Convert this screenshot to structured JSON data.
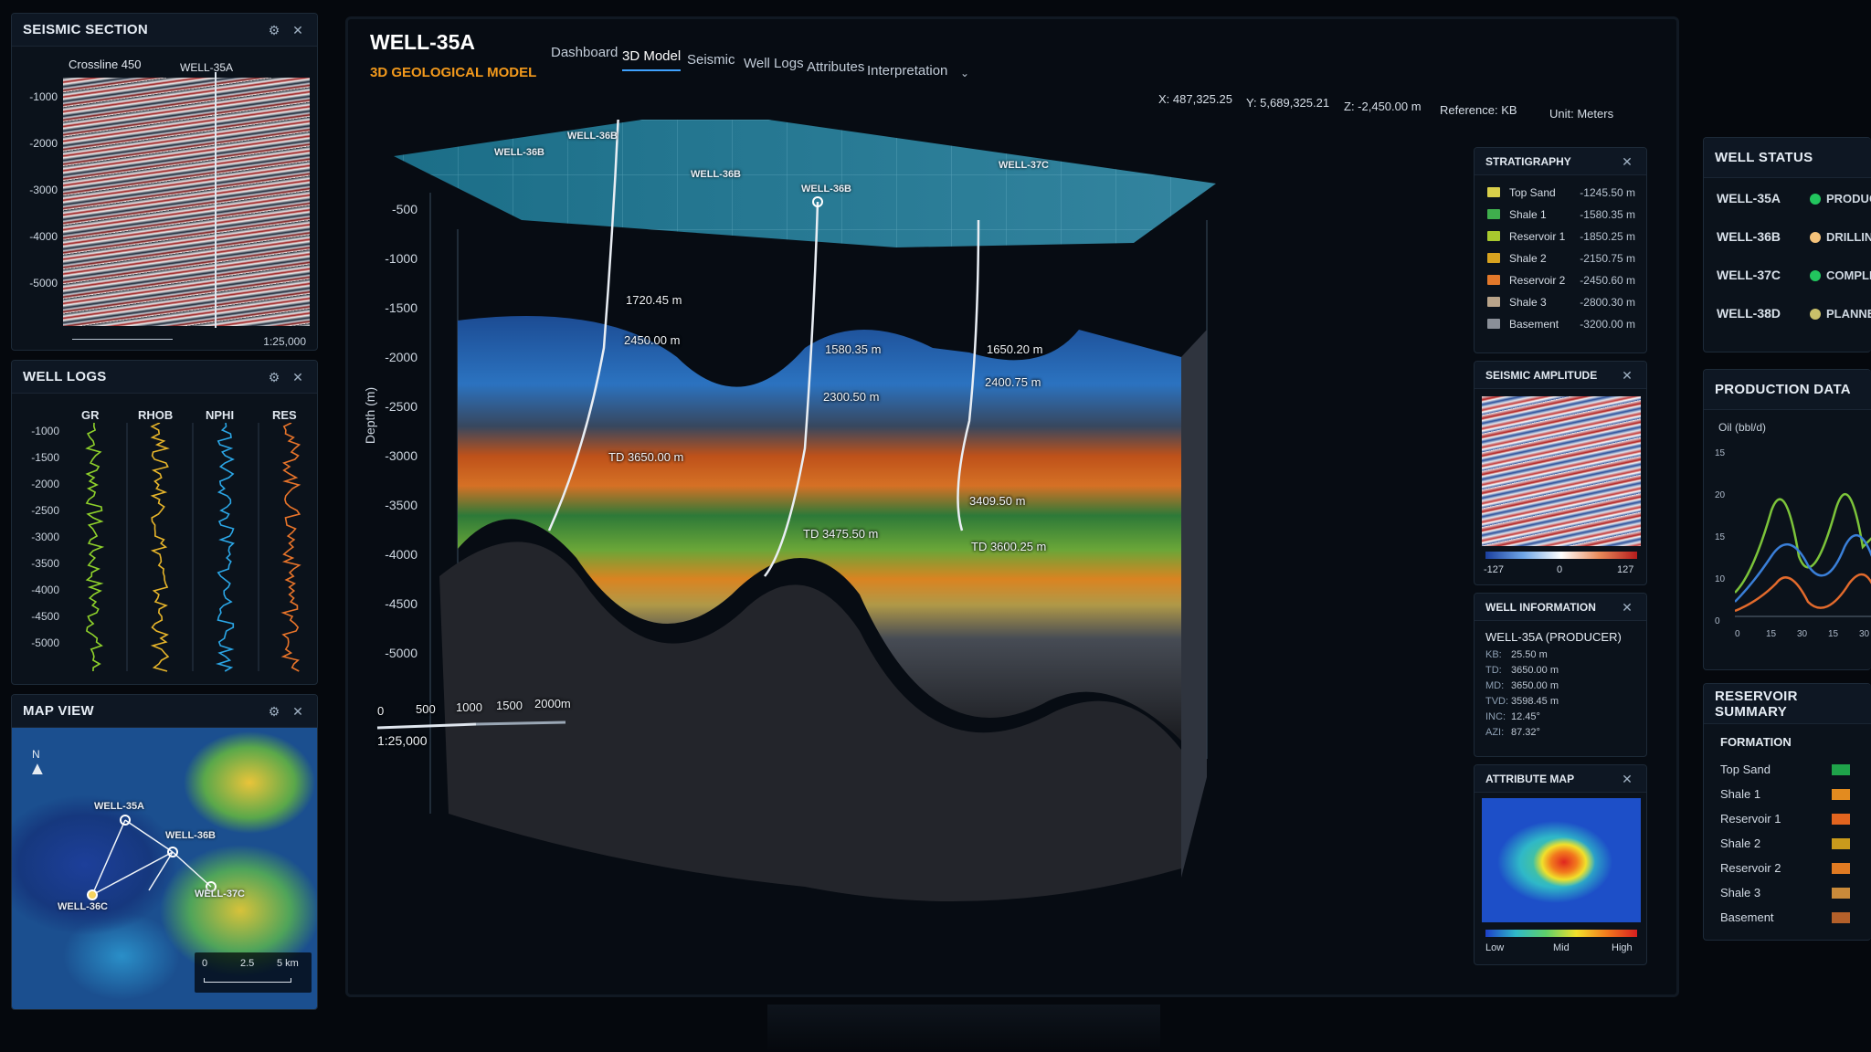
{
  "seismic_section": {
    "title": "SEISMIC SECTION",
    "crossline": "Crossline 450",
    "well": "WELL-35A",
    "depths": [
      "-1000",
      "-2000",
      "-3000",
      "-4000",
      "-5000"
    ],
    "scale": "1:25,000"
  },
  "well_logs": {
    "title": "WELL LOGS",
    "columns": [
      "GR",
      "RHOB",
      "NPHI",
      "RES"
    ],
    "colors": [
      "#8fd22b",
      "#e7b52a",
      "#2ba6e6",
      "#e8742a"
    ],
    "depths": [
      "-1000",
      "-1500",
      "-2000",
      "-2500",
      "-3000",
      "-3500",
      "-4000",
      "-4500",
      "-5000"
    ]
  },
  "map_view": {
    "title": "MAP VIEW",
    "north": "N",
    "wells": [
      "WELL-35A",
      "WELL-36B",
      "WELL-37C",
      "WELL-36C"
    ],
    "scale_ticks": [
      "0",
      "2.5",
      "5 km"
    ]
  },
  "header": {
    "well_name": "WELL-35A",
    "subtitle": "3D GEOLOGICAL MODEL",
    "tabs": [
      "Dashboard",
      "3D Model",
      "Seismic",
      "Well Logs",
      "Attributes",
      "Interpretation"
    ],
    "active_tab": "3D Model",
    "x": "X: 487,325.25",
    "y": "Y: 5,689,325.21",
    "z": "Z: -2,450.00 m",
    "reference": "Reference: KB",
    "unit": "Unit: Meters"
  },
  "model": {
    "depth_axis_label": "Depth (m)",
    "depth_ticks": [
      "-500",
      "-1000",
      "-1500",
      "-2000",
      "-2500",
      "-3000",
      "-3500",
      "-4000",
      "-4500",
      "-5000"
    ],
    "surface_wells": [
      "WELL-36B",
      "WELL-36B",
      "WELL-36B",
      "WELL-36B",
      "WELL-37C"
    ],
    "annotations": {
      "w1_a": "1720.45 m",
      "w1_b": "2450.00 m",
      "w1_td": "TD 3650.00 m",
      "w2_a": "1580.35 m",
      "w2_b": "2300.50 m",
      "w2_td": "TD 3475.50 m",
      "w3_a": "1650.20 m",
      "w3_b": "2400.75 m",
      "w3_c": "3409.50 m",
      "w3_td": "TD 3600.25 m"
    },
    "scale_ticks": [
      "0",
      "500",
      "1000",
      "1500",
      "2000m"
    ],
    "scale_ratio": "1:25,000"
  },
  "stratigraphy": {
    "title": "STRATIGRAPHY",
    "layers": [
      {
        "name": "Top Sand",
        "depth": "-1245.50 m",
        "color": "#d9cf4a"
      },
      {
        "name": "Shale 1",
        "depth": "-1580.35 m",
        "color": "#3fae4d"
      },
      {
        "name": "Reservoir 1",
        "depth": "-1850.25 m",
        "color": "#a8c92e"
      },
      {
        "name": "Shale 2",
        "depth": "-2150.75 m",
        "color": "#d7a21f"
      },
      {
        "name": "Reservoir 2",
        "depth": "-2450.60 m",
        "color": "#e2782a"
      },
      {
        "name": "Shale 3",
        "depth": "-2800.30 m",
        "color": "#b9a48a"
      },
      {
        "name": "Basement",
        "depth": "-3200.00 m",
        "color": "#8a8f98"
      }
    ]
  },
  "seismic_amplitude": {
    "title": "SEISMIC AMPLITUDE",
    "min": "-127",
    "mid": "0",
    "max": "127"
  },
  "well_information": {
    "title": "WELL INFORMATION",
    "name": "WELL-35A (PRODUCER)",
    "rows": [
      {
        "k": "KB:",
        "v": "25.50 m"
      },
      {
        "k": "TD:",
        "v": "3650.00 m"
      },
      {
        "k": "MD:",
        "v": "3650.00 m"
      },
      {
        "k": "TVD:",
        "v": "3598.45 m"
      },
      {
        "k": "INC:",
        "v": "12.45°"
      },
      {
        "k": "AZI:",
        "v": "87.32°"
      }
    ]
  },
  "attribute_map": {
    "title": "ATTRIBUTE MAP",
    "low": "Low",
    "mid": "Mid",
    "high": "High"
  },
  "well_status": {
    "title": "WELL STATUS",
    "rows": [
      {
        "well": "WELL-35A",
        "status": "PRODUC",
        "color": "#22c55e"
      },
      {
        "well": "WELL-36B",
        "status": "DRILLIN",
        "color": "#f4c27a"
      },
      {
        "well": "WELL-37C",
        "status": "COMPLE",
        "color": "#22c55e"
      },
      {
        "well": "WELL-38D",
        "status": "PLANNE",
        "color": "#c9c06a"
      }
    ]
  },
  "production_data": {
    "title": "PRODUCTION DATA",
    "ylabel": "Oil (bbl/d)",
    "y_ticks": [
      "15",
      "20",
      "15",
      "10",
      "0"
    ],
    "x_ticks": [
      "0",
      "15",
      "30",
      "15",
      "30"
    ]
  },
  "reservoir_summary": {
    "title": "RESERVOIR SUMMARY",
    "header": "FORMATION",
    "rows": [
      {
        "name": "Top Sand",
        "color": "#1fa34a"
      },
      {
        "name": "Shale 1",
        "color": "#e38b1f"
      },
      {
        "name": "Reservoir 1",
        "color": "#e2641f"
      },
      {
        "name": "Shale 2",
        "color": "#c99a1c"
      },
      {
        "name": "Reservoir 2",
        "color": "#e07a22"
      },
      {
        "name": "Shale 3",
        "color": "#c98a3a"
      },
      {
        "name": "Basement",
        "color": "#b4602a"
      }
    ]
  }
}
